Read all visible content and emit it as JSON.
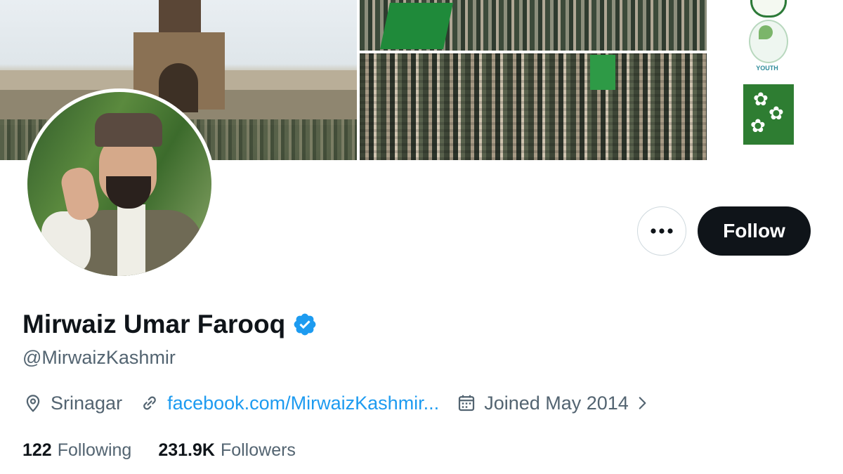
{
  "banner": {
    "logo_text": "YOUTH"
  },
  "actions": {
    "more_label": "More",
    "follow_label": "Follow"
  },
  "profile": {
    "display_name": "Mirwaiz Umar Farooq",
    "handle": "@MirwaizKashmir",
    "location": "Srinagar",
    "website": "facebook.com/MirwaizKashmir...",
    "joined": "Joined May 2014",
    "following_count": "122",
    "following_label": "Following",
    "followers_count": "231.9K",
    "followers_label": "Followers"
  },
  "colors": {
    "accent": "#1d9bf0",
    "primary_text": "#0f1419",
    "secondary_text": "#536471",
    "follow_bg": "#0f1419"
  },
  "icons": {
    "verified": "verified-badge-icon",
    "location": "location-pin-icon",
    "link": "link-icon",
    "calendar": "calendar-icon",
    "chevron": "chevron-right-icon",
    "more": "more-dots-icon"
  }
}
